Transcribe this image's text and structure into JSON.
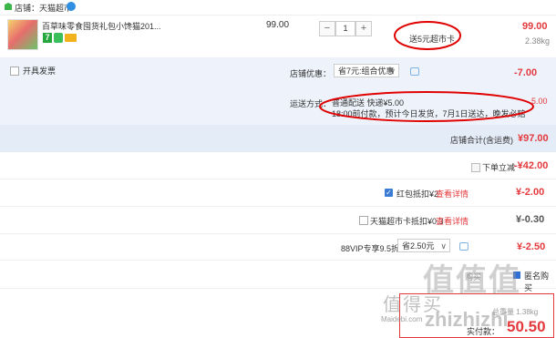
{
  "store": {
    "name": "店铺：天猫超市"
  },
  "item": {
    "title": "百草味零食囤货礼包小馋猫201...",
    "tag_badge": "7",
    "unit_price": "99.00",
    "quantity": "1",
    "minus": "−",
    "plus": "+",
    "deal_text": "送5元超市卡",
    "subtotal": "99.00",
    "weight": "2.38kg"
  },
  "invoice": {
    "label": "开具发票"
  },
  "promo": {
    "label": "店铺优惠：",
    "selected": "省7元:组合优惠",
    "amount": "-7.00"
  },
  "shipping": {
    "label": "运送方式：",
    "line1": "普通配送 快递¥5.00",
    "line2": "18:00前付款，预计今日发货，7月1日送达，晚发必赔",
    "amount": "5.00"
  },
  "store_total": {
    "label": "店铺合计(含运费)",
    "amount": "¥97.00"
  },
  "order_discount": {
    "label": "下单立减",
    "amount": "-¥42.00"
  },
  "redpack": {
    "label": "红包抵扣¥2",
    "link": "查看详情",
    "amount": "¥-2.00"
  },
  "card": {
    "label": "天猫超市卡抵扣¥0.3",
    "link": "查看详情",
    "amount": "¥-0.30"
  },
  "vip": {
    "label": "88VIP专享9.5折",
    "selected": "省2.50元",
    "amount": "¥-2.50"
  },
  "anonymous": {
    "left_text": "购买",
    "label": "匿名购买"
  },
  "payment": {
    "label": "实付款：",
    "amount": "50.50",
    "weight_text": "总重量 1.38kg"
  },
  "watermark": {
    "text_cn": "值得买",
    "text_url": "Maidebi.com",
    "logo_text": "值值值",
    "domain": "zhizhizhi"
  },
  "colors": {
    "price_red": "#e4393c",
    "panel_blue": "#eef3fb",
    "total_blue": "#e4ecf8",
    "annotation_red": "#e00000"
  }
}
